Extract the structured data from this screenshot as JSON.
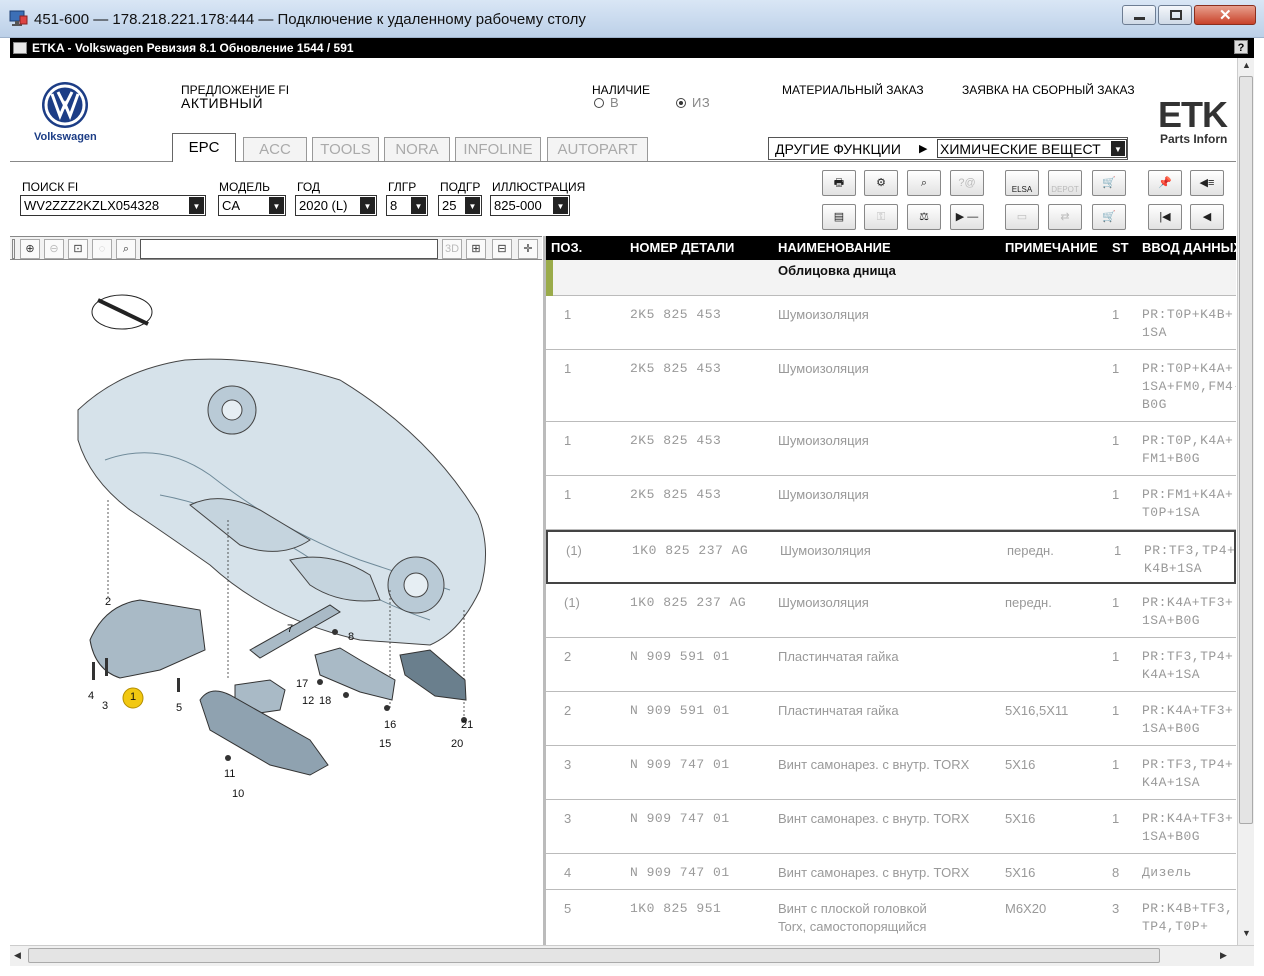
{
  "rdp": {
    "title": "451-600 — 178.218.221.178:444 — Подключение к удаленному рабочему столу"
  },
  "app": {
    "title": "ETKA - Volkswagen Ревизия 8.1 Обновление 1544 / 591",
    "help": "?"
  },
  "brand": {
    "name": "Volkswagen",
    "logo_text": "ETK",
    "logo_sub": "Parts Inforn"
  },
  "header": {
    "offer_label": "ПРЕДЛОЖЕНИЕ FI",
    "offer_value": "АКТИВНЫЙ",
    "availability_label": "НАЛИЧИЕ",
    "radio_v": "В",
    "radio_iz": "ИЗ",
    "material_order": "МАТЕРИАЛЬНЫЙ ЗАКАЗ",
    "assembly_order": "ЗАЯВКА НА СБОРНЫЙ ЗАКАЗ",
    "other_functions": "ДРУГИЕ ФУНКЦИИ",
    "chemicals": "ХИМИЧЕСКИЕ ВЕЩЕСТ"
  },
  "tabs": [
    {
      "label": "EPC",
      "active": true
    },
    {
      "label": "ACC"
    },
    {
      "label": "TOOLS"
    },
    {
      "label": "NORA"
    },
    {
      "label": "INFOLINE"
    },
    {
      "label": "AUTOPART"
    }
  ],
  "search": {
    "fi_label": "ПОИСК FI",
    "fi_value": "WV2ZZZ2KZLX054328",
    "model_label": "МОДЕЛЬ",
    "model_value": "CA",
    "year_label": "ГОД",
    "year_value": "2020 (L)",
    "mg_label": "ГЛГР",
    "mg_value": "8",
    "sg_label": "ПОДГР",
    "sg_value": "25",
    "ill_label": "ИЛЛЮСТРАЦИЯ",
    "ill_value": "825-000"
  },
  "toolbar": {
    "elsa": "ELSA",
    "depot": "DEPOT"
  },
  "table": {
    "headers": {
      "pos": "ПОЗ.",
      "part": "НОМЕР ДЕТАЛИ",
      "name": "НАИМЕНОВАНИЕ",
      "note": "ПРИМЕЧАНИЕ",
      "st": "ST",
      "input": "ВВОД ДАННЫХ"
    },
    "group": "Облицовка днища",
    "rows": [
      {
        "pos": "1",
        "part": "2K5  825  453",
        "name": "Шумоизоляция",
        "note": "",
        "st": "1",
        "input": "PR:T0P+K4B+\n1SA"
      },
      {
        "pos": "1",
        "part": "2K5  825  453",
        "name": "Шумоизоляция",
        "note": "",
        "st": "1",
        "input": "PR:T0P+K4A+\n1SA+FM0,FM4-\nB0G"
      },
      {
        "pos": "1",
        "part": "2K5  825  453",
        "name": "Шумоизоляция",
        "note": "",
        "st": "1",
        "input": "PR:T0P,K4A+\nFM1+B0G"
      },
      {
        "pos": "1",
        "part": "2K5  825  453",
        "name": "Шумоизоляция",
        "note": "",
        "st": "1",
        "input": "PR:FM1+K4A+\nT0P+1SA"
      },
      {
        "pos": "(1)",
        "part": "1K0  825  237  AG",
        "name": "Шумоизоляция",
        "note": "передн.",
        "st": "1",
        "input": "PR:TF3,TP4+\nK4B+1SA"
      },
      {
        "pos": "(1)",
        "part": "1K0  825  237  AG",
        "name": "Шумоизоляция",
        "note": "передн.",
        "st": "1",
        "input": "PR:K4A+TF3+\n1SA+B0G"
      },
      {
        "pos": "2",
        "part": "N    909  591  01",
        "name": "Пластинчатая гайка",
        "note": "",
        "st": "1",
        "input": "PR:TF3,TP4+\nK4A+1SA"
      },
      {
        "pos": "2",
        "part": "N    909  591  01",
        "name": "Пластинчатая гайка",
        "note": "5X16,5X11",
        "st": "1",
        "input": "PR:K4A+TF3+\n1SA+B0G"
      },
      {
        "pos": "3",
        "part": "N    909  747  01",
        "name": "Винт самонарез. с внутр. TORX",
        "note": "5X16",
        "st": "1",
        "input": "PR:TF3,TP4+\nK4A+1SA"
      },
      {
        "pos": "3",
        "part": "N    909  747  01",
        "name": "Винт самонарез. с внутр. TORX",
        "note": "5X16",
        "st": "1",
        "input": "PR:K4A+TF3+\n1SA+B0G"
      },
      {
        "pos": "4",
        "part": "N    909  747  01",
        "name": "Винт самонарез. с внутр. TORX",
        "note": "5X16",
        "st": "8",
        "input": "Дизель"
      },
      {
        "pos": "5",
        "part": "1K0  825  951",
        "name": "Винт с плоской головкой\nTorx, самостопорящийся",
        "note": "M6X20",
        "st": "3",
        "input": "PR:K4B+TF3,\nTP4,T0P+"
      }
    ]
  },
  "diagram": {
    "callouts": [
      "1",
      "2",
      "3",
      "4",
      "5",
      "7",
      "8",
      "10",
      "11",
      "12",
      "15",
      "16",
      "17",
      "18",
      "20",
      "21"
    ]
  }
}
